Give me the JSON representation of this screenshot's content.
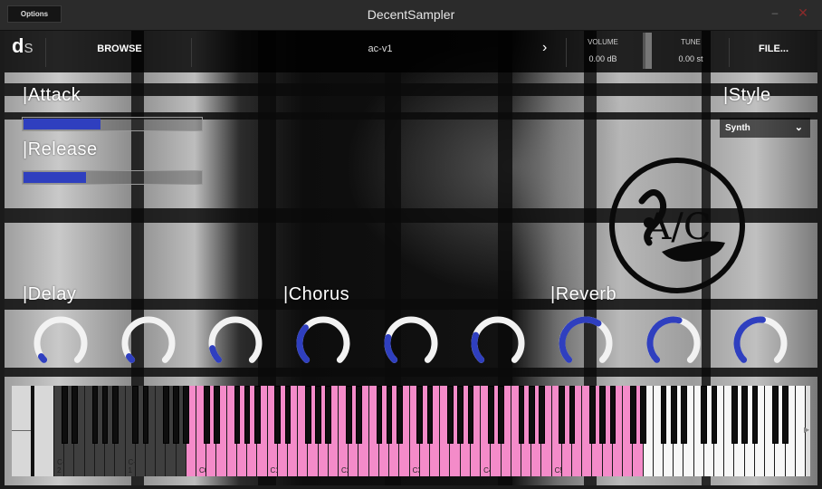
{
  "window": {
    "title": "DecentSampler",
    "options_label": "Options",
    "minimize_glyph": "–",
    "close_glyph": "✕"
  },
  "header": {
    "logo_main": "d",
    "logo_sub": "S",
    "browse_label": "BROWSE",
    "preset_name": "ac-v1",
    "next_glyph": "›",
    "volume_label": "VOLUME",
    "volume_value": "0.00 dB",
    "tune_label": "TUNE",
    "tune_value": "0.00 st",
    "file_label": "FILE..."
  },
  "controls": {
    "attack_label": "|Attack",
    "attack_level": 0.43,
    "release_label": "|Release",
    "release_level": 0.35,
    "style_label": "|Style",
    "style_value": "Synth",
    "style_chevron": "⌄",
    "delay_label": "|Delay",
    "chorus_label": "|Chorus",
    "reverb_label": "|Reverb"
  },
  "logo_art": {
    "text": "A/C"
  },
  "knobs": [
    {
      "group": "delay",
      "level": 0.04
    },
    {
      "group": "delay",
      "level": 0.04
    },
    {
      "group": "delay",
      "level": 0.12
    },
    {
      "group": "chorus",
      "level": 0.32
    },
    {
      "group": "chorus",
      "level": 0.22
    },
    {
      "group": "chorus",
      "level": 0.24
    },
    {
      "group": "reverb",
      "level": 0.62
    },
    {
      "group": "reverb",
      "level": 0.55
    },
    {
      "group": "reverb",
      "level": 0.52
    }
  ],
  "keyboard": {
    "octave_labels": [
      "C-2",
      "C-1",
      "C0",
      "C1",
      "C2",
      "C3",
      "C4",
      "C5"
    ],
    "right_arrow": "▶",
    "colors": {
      "inactive": "#3f3f3f",
      "mapped": "#f48bc9",
      "outside": "#f7f7f7"
    }
  },
  "colors": {
    "accent": "#2f3fbf",
    "knob_track": "#f2f2f2"
  }
}
